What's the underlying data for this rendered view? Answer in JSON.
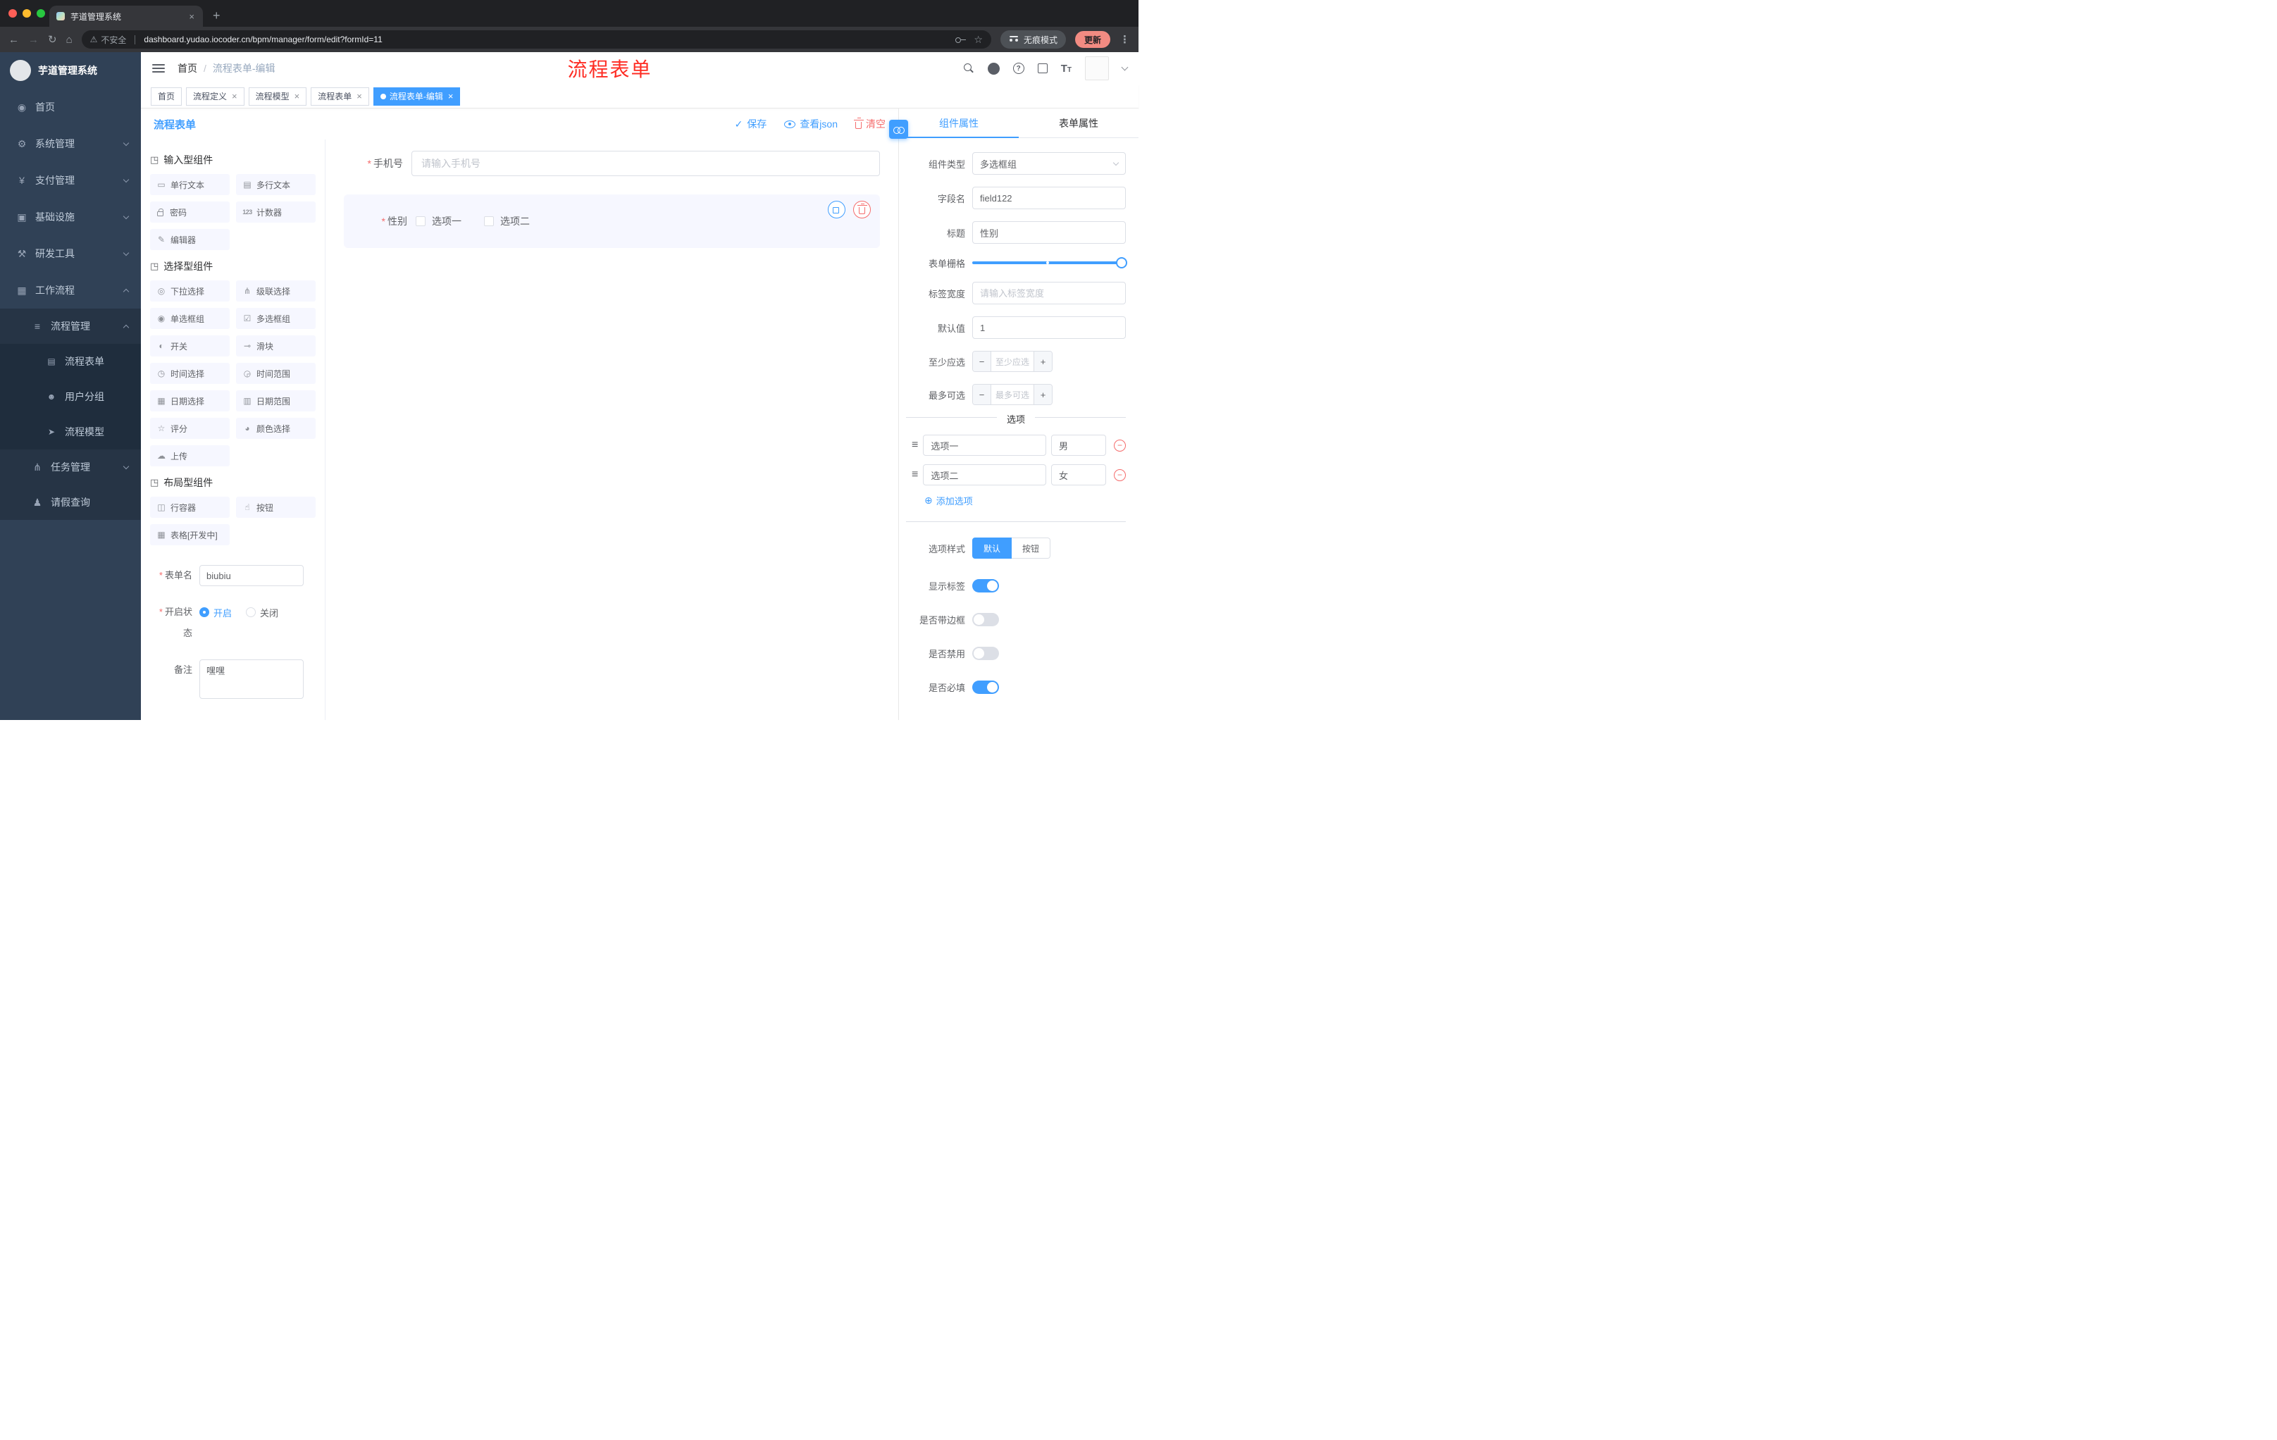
{
  "colors": {
    "accent": "#409eff",
    "danger": "#f56c6c",
    "annotation": "#fe2c23",
    "sidebar_bg": "#304156",
    "submenu_bg": "#263445"
  },
  "browser": {
    "tab_title": "芋道管理系统",
    "security_label": "不安全",
    "url": "dashboard.yudao.iocoder.cn/bpm/manager/form/edit?formId=11",
    "incognito_label": "无痕模式",
    "update_label": "更新"
  },
  "icons": {
    "back": "←",
    "forward": "→",
    "reload": "↻",
    "home": "⌂",
    "warning": "⚠",
    "star": "☆",
    "more": "⋮",
    "new_tab": "+",
    "close": "×",
    "crumb_sep": "/",
    "group_drag": "◳",
    "check": "✓",
    "minus": "−",
    "plus": "+",
    "add_circle": "⊕",
    "option_drag": "≡"
  },
  "sidebar": {
    "logo_title": "芋道管理系统",
    "items": [
      {
        "label": "首页",
        "icon": "◉"
      },
      {
        "label": "系统管理",
        "icon": "⚙"
      },
      {
        "label": "支付管理",
        "icon": "¥"
      },
      {
        "label": "基础设施",
        "icon": "▣"
      },
      {
        "label": "研发工具",
        "icon": "⚒"
      },
      {
        "label": "工作流程",
        "icon": "▦"
      },
      {
        "label": "流程管理",
        "icon": "≡"
      },
      {
        "label": "流程表单",
        "icon": "▤"
      },
      {
        "label": "用户分组",
        "icon": "☻"
      },
      {
        "label": "流程模型",
        "icon": "➤"
      },
      {
        "label": "任务管理",
        "icon": "⋔"
      },
      {
        "label": "请假查询",
        "icon": "♟"
      }
    ]
  },
  "header": {
    "breadcrumb_home": "首页",
    "breadcrumb_current": "流程表单-编辑",
    "annotation": "流程表单"
  },
  "tags": {
    "items": [
      "首页",
      "流程定义",
      "流程模型",
      "流程表单",
      "流程表单-编辑"
    ]
  },
  "designer": {
    "title": "流程表单",
    "save": "保存",
    "view_json": "查看json",
    "clear": "清空"
  },
  "palette": {
    "group1": {
      "title": "输入型组件",
      "items": [
        {
          "icon": "▭",
          "label": "单行文本"
        },
        {
          "icon": "▤",
          "label": "多行文本"
        },
        {
          "icon": "",
          "label": "密码"
        },
        {
          "icon": "123",
          "label": "计数器"
        },
        {
          "icon": "✎",
          "label": "编辑器"
        }
      ]
    },
    "group2": {
      "title": "选择型组件",
      "items": [
        {
          "icon": "◎",
          "label": "下拉选择"
        },
        {
          "icon": "⋔",
          "label": "级联选择"
        },
        {
          "icon": "◉",
          "label": "单选框组"
        },
        {
          "icon": "☑",
          "label": "多选框组"
        },
        {
          "icon": "◐",
          "label": "开关"
        },
        {
          "icon": "⊸",
          "label": "滑块"
        },
        {
          "icon": "◷",
          "label": "时间选择"
        },
        {
          "icon": "◶",
          "label": "时间范围"
        },
        {
          "icon": "▦",
          "label": "日期选择"
        },
        {
          "icon": "▥",
          "label": "日期范围"
        },
        {
          "icon": "☆",
          "label": "评分"
        },
        {
          "icon": "◕",
          "label": "颜色选择"
        },
        {
          "icon": "☁",
          "label": "上传"
        }
      ]
    },
    "group3": {
      "title": "布局型组件",
      "items": [
        {
          "icon": "◫",
          "label": "行容器"
        },
        {
          "icon": "☝",
          "label": "按钮"
        },
        {
          "icon": "▦",
          "label": "表格[开发中]"
        }
      ]
    }
  },
  "meta_form": {
    "name_label": "表单名",
    "name_value": "biubiu",
    "status_label": "开启状态",
    "status_on": "开启",
    "status_off": "关闭",
    "remark_label": "备注",
    "remark_value": "嘿嘿"
  },
  "canvas": {
    "phone_label": "手机号",
    "phone_placeholder": "请输入手机号",
    "gender_label": "性别",
    "gender_option1": "选项一",
    "gender_option2": "选项二"
  },
  "props": {
    "tab_component": "组件属性",
    "tab_form": "表单属性",
    "type_label": "组件类型",
    "type_value": "多选框组",
    "field_label": "字段名",
    "field_value": "field122",
    "title_label": "标题",
    "title_value": "性别",
    "grid_label": "表单栅格",
    "width_label": "标签宽度",
    "width_placeholder": "请输入标签宽度",
    "default_label": "默认值",
    "default_value": "1",
    "min_label": "至少应选",
    "min_placeholder": "至少应选",
    "max_label": "最多可选",
    "max_placeholder": "最多可选",
    "options_title": "选项",
    "options": [
      {
        "name": "选项一",
        "value": "男"
      },
      {
        "name": "选项二",
        "value": "女"
      }
    ],
    "add_option": "添加选项",
    "style_label": "选项样式",
    "style_default": "默认",
    "style_button": "按钮",
    "show_label": "显示标签",
    "border_label": "是否带边框",
    "disabled_label": "是否禁用",
    "required_label": "是否必填"
  }
}
